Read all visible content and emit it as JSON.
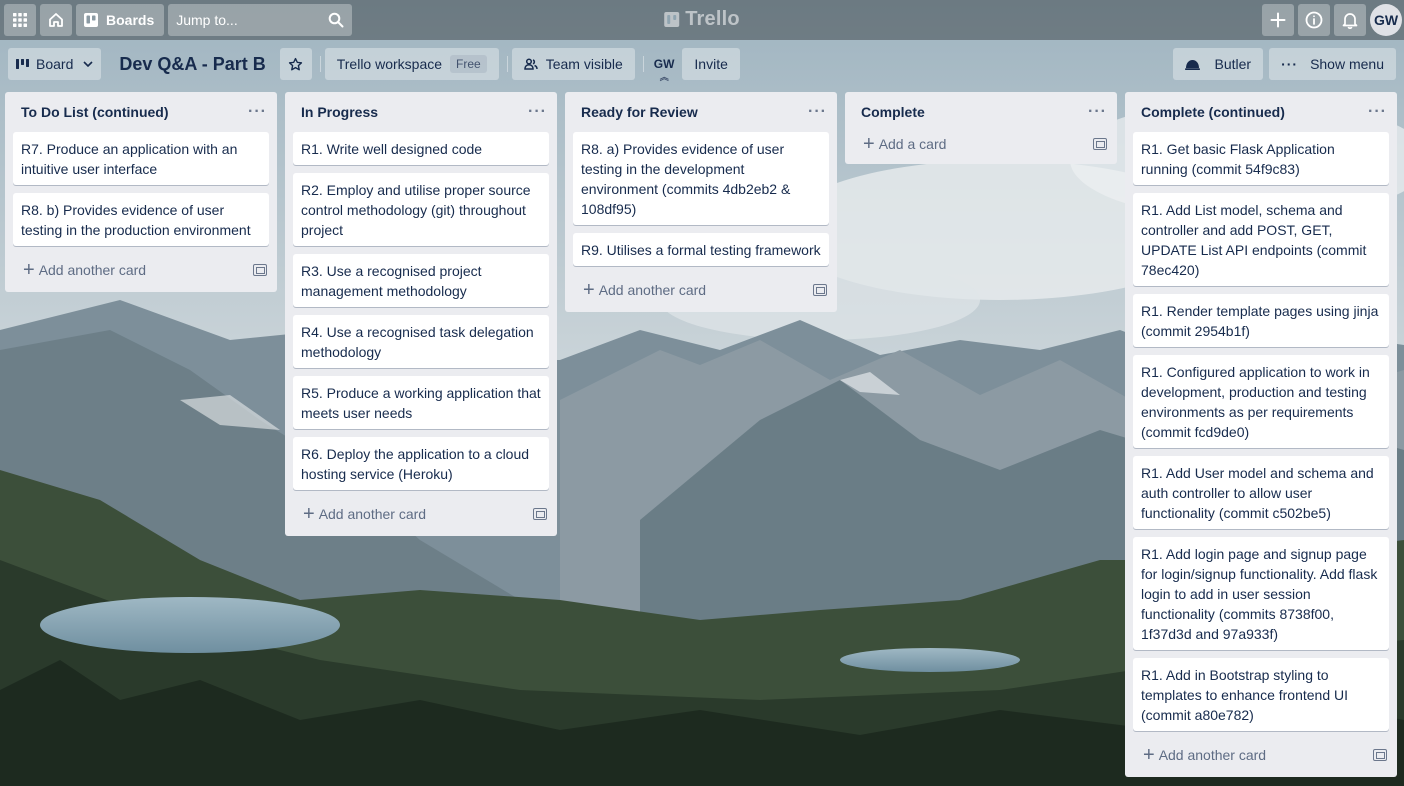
{
  "topbar": {
    "boards_label": "Boards",
    "search_placeholder": "Jump to...",
    "logo_text": "Trello",
    "avatar_initials": "GW"
  },
  "boardbar": {
    "view_label": "Board",
    "title": "Dev Q&A - Part B",
    "workspace_label": "Trello workspace",
    "workspace_plan": "Free",
    "visibility_label": "Team visible",
    "member_initials": "GW",
    "invite_label": "Invite",
    "butler_label": "Butler",
    "menu_label": "Show menu"
  },
  "lists": [
    {
      "title": "To Do List (continued)",
      "cards": [
        "R7. Produce an application with an intuitive user interface",
        "R8. b) Provides evidence of user testing in the production environment"
      ],
      "add_label": "Add another card"
    },
    {
      "title": "In Progress",
      "cards": [
        "R1. Write well designed code",
        "R2. Employ and utilise proper source control methodology (git) throughout project",
        "R3. Use a recognised project management methodology",
        "R4. Use a recognised task delegation methodology",
        "R5. Produce a working application that meets user needs",
        "R6. Deploy the application to a cloud hosting service (Heroku)"
      ],
      "add_label": "Add another card"
    },
    {
      "title": "Ready for Review",
      "cards": [
        "R8. a) Provides evidence of user testing in the development environment (commits 4db2eb2 & 108df95)",
        "R9. Utilises a formal testing framework"
      ],
      "add_label": "Add another card"
    },
    {
      "title": "Complete",
      "cards": [],
      "add_label": "Add a card"
    },
    {
      "title": "Complete (continued)",
      "cards": [
        "R1. Get basic Flask Application running (commit 54f9c83)",
        "R1. Add List model, schema and controller and add POST, GET, UPDATE List API endpoints (commit 78ec420)",
        "R1. Render template pages using jinja (commit 2954b1f)",
        "R1. Configured application to work in development, production and testing environments as per requirements (commit fcd9de0)",
        "R1. Add User model and schema and auth controller to allow user functionality (commit c502be5)",
        "R1. Add login page and signup page for login/signup functionality. Add flask login to add in user session functionality (commits 8738f00, 1f37d3d and 97a933f)",
        "R1. Add in Bootstrap styling to templates to enhance frontend UI (commit a80e782)"
      ],
      "add_label": "Add another card"
    }
  ],
  "icons": [
    "apps-icon",
    "home-icon",
    "boards-icon",
    "search-icon",
    "plus-icon",
    "info-icon",
    "bell-icon",
    "star-icon",
    "lock-icon",
    "butler-icon",
    "more-icon",
    "template-icon"
  ]
}
